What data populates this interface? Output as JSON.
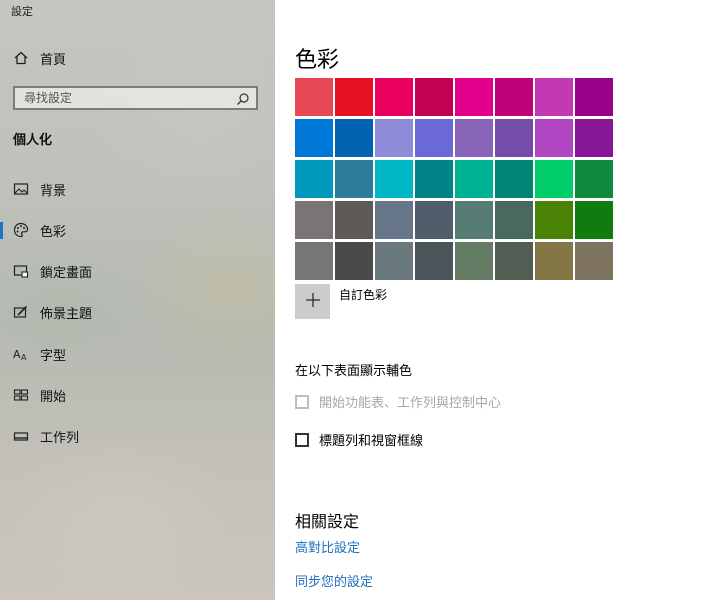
{
  "window": {
    "title": "設定"
  },
  "sidebar": {
    "home_label": "首頁",
    "search_placeholder": "尋找設定",
    "section_title": "個人化",
    "items": [
      {
        "label": "背景",
        "icon": "image-icon"
      },
      {
        "label": "色彩",
        "icon": "palette-icon",
        "selected": true
      },
      {
        "label": "鎖定畫面",
        "icon": "lock-screen-icon"
      },
      {
        "label": "佈景主題",
        "icon": "theme-brush-icon"
      },
      {
        "label": "字型",
        "icon": "font-icon"
      },
      {
        "label": "開始",
        "icon": "start-grid-icon"
      },
      {
        "label": "工作列",
        "icon": "taskbar-icon"
      }
    ]
  },
  "main": {
    "title": "色彩",
    "swatches": [
      "#e74856",
      "#e81123",
      "#ea005e",
      "#c30052",
      "#e3008c",
      "#bf0077",
      "#c239b3",
      "#9a0089",
      "#0078d7",
      "#0063b1",
      "#8e8cd8",
      "#6b69d6",
      "#8764b8",
      "#744da9",
      "#b146c2",
      "#881798",
      "#0099bc",
      "#2d7d9a",
      "#00b7c3",
      "#038387",
      "#00b294",
      "#018574",
      "#00cc6a",
      "#10893e",
      "#7a7574",
      "#5d5a58",
      "#68768a",
      "#515c6b",
      "#567c73",
      "#486860",
      "#498205",
      "#107c10",
      "#767676",
      "#4c4a48",
      "#69797e",
      "#4a5459",
      "#647c64",
      "#525e54",
      "#847545",
      "#7e735f"
    ],
    "custom_color_label": "自訂色彩",
    "accent_section_title": "在以下表面顯示輔色",
    "checkboxes": [
      {
        "label": "開始功能表、工作列與控制中心",
        "checked": false,
        "disabled": true
      },
      {
        "label": "標題列和視窗框線",
        "checked": false,
        "disabled": false
      }
    ],
    "related_title": "相關設定",
    "links": [
      "高對比設定",
      "同步您的設定"
    ]
  },
  "colors": {
    "accent": "#1e74c8",
    "link": "#1f6fbf"
  }
}
